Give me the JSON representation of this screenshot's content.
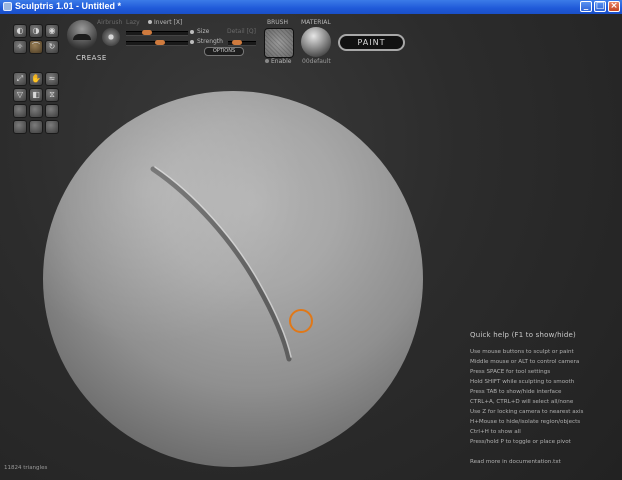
{
  "window": {
    "title": "Sculptris 1.01 - Untitled *",
    "minimize_glyph": "_",
    "maximize_glyph": "□",
    "close_glyph": "×"
  },
  "toolbar": {
    "tools": [
      {
        "name": "draw-tool-icon",
        "glyph": "◐"
      },
      {
        "name": "flatten-tool-icon",
        "glyph": "◑"
      },
      {
        "name": "inflate-tool-icon",
        "glyph": "◉"
      },
      {
        "name": "pinch-tool-icon",
        "glyph": "✧"
      },
      {
        "name": "crease-tool-icon",
        "glyph": "⌒",
        "active": true
      },
      {
        "name": "rotate-tool-icon",
        "glyph": "↻"
      },
      {
        "name": "scale-tool-icon",
        "glyph": "⤢"
      },
      {
        "name": "grab-tool-icon",
        "glyph": "✋"
      },
      {
        "name": "smooth-tool-icon",
        "glyph": "≈"
      },
      {
        "name": "reduce-tool-icon",
        "glyph": "▽"
      },
      {
        "name": "mask-tool-icon",
        "glyph": "◧"
      },
      {
        "name": "symmetry-tool-icon",
        "glyph": "⧖"
      }
    ]
  },
  "brush_panel": {
    "tool_name": "CREASE",
    "airbrush_label": "Airbrush",
    "lazy_label": "Lazy",
    "invert_label": "Invert [X]",
    "size_label": "Size",
    "strength_label": "Strength",
    "detail_label": "Detail [Q]",
    "options_label": "OPTIONS",
    "size_value": 0.3,
    "strength_value": 0.55,
    "detail_value": 0.2
  },
  "brush_section": {
    "label": "BRUSH",
    "enable_label": "Enable"
  },
  "material_section": {
    "label": "MATERIAL",
    "material_name": "00default"
  },
  "paint_button": "PAINT",
  "help": {
    "title": "Quick help (F1 to show/hide)",
    "lines": [
      "Use mouse buttons to sculpt or paint",
      "Middle mouse or ALT to control camera",
      "Press SPACE for tool settings",
      "Hold SHIFT while sculpting to smooth",
      "Press TAB to show/hide interface",
      "CTRL+A, CTRL+D will select all/none",
      "Use Z for locking camera to nearest axis",
      "H+Mouse to hide/isolate region/objects",
      "Ctrl+H to show all",
      "Press/hold P to toggle or place pivot",
      "",
      "Read more in documentation.txt"
    ]
  },
  "status": {
    "triangles": "11824 triangles"
  },
  "colors": {
    "accent": "#d07b3e",
    "cursor_ring": "#e07818",
    "titlebar": "#1f59d8"
  }
}
